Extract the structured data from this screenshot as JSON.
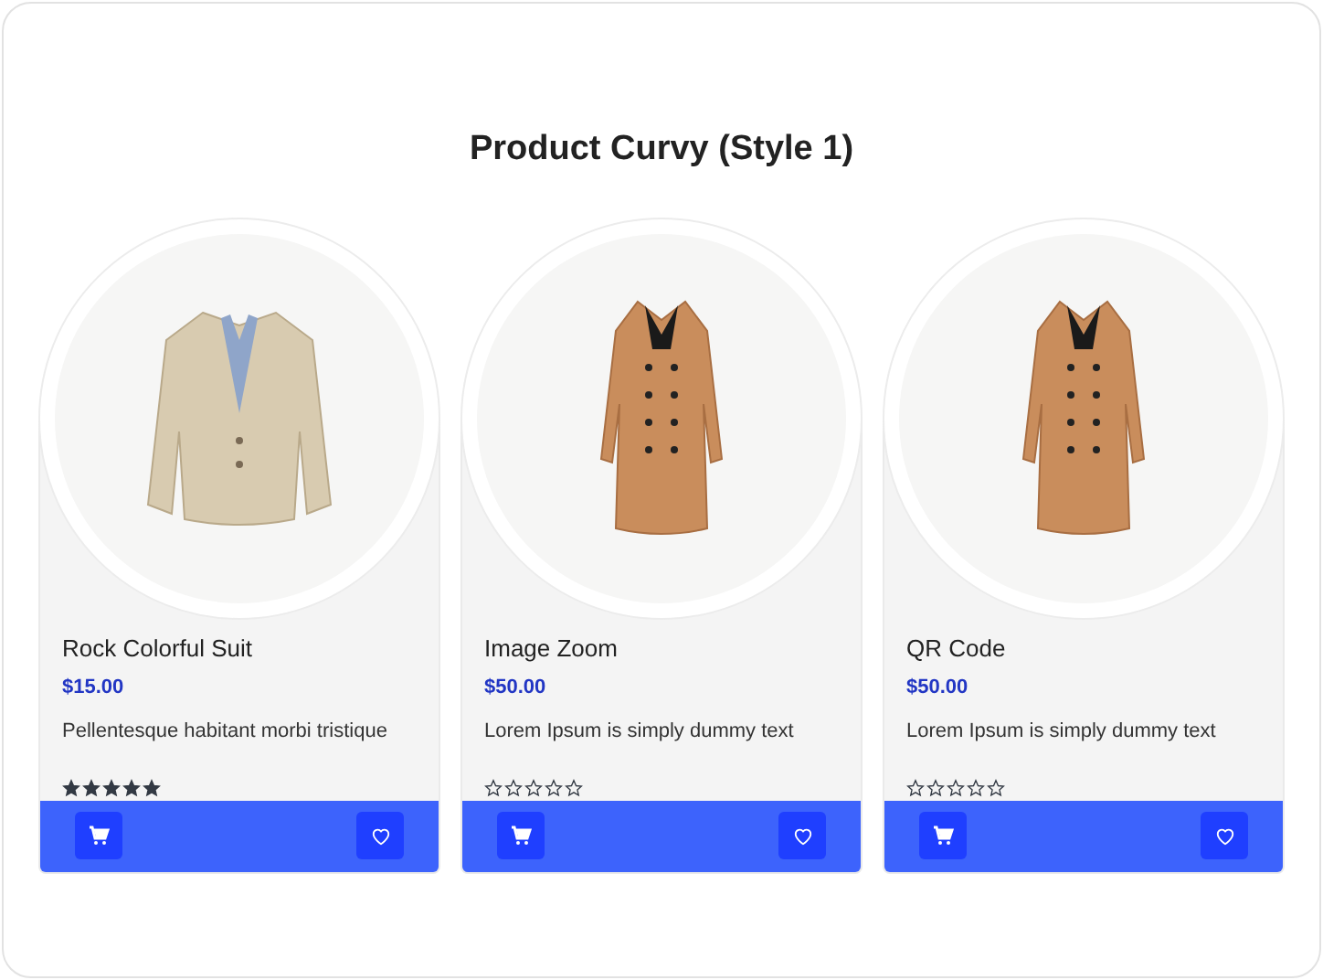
{
  "title": "Product Curvy (Style 1)",
  "products": [
    {
      "kind": "suit",
      "name": "Rock Colorful Suit",
      "price": "$15.00",
      "description": "Pellentesque habitant morbi tristique",
      "stars": 5
    },
    {
      "kind": "coat",
      "name": "Image Zoom",
      "price": "$50.00",
      "description": "Lorem Ipsum is simply dummy text",
      "stars": 0
    },
    {
      "kind": "coat",
      "name": "QR Code",
      "price": "$50.00",
      "description": "Lorem Ipsum is simply dummy text",
      "stars": 0
    }
  ]
}
